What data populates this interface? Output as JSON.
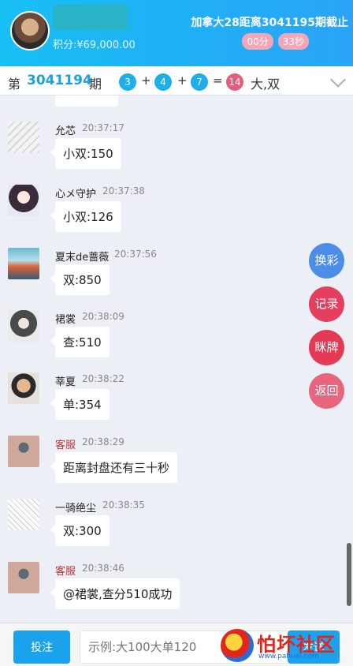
{
  "header": {
    "score": "积分:¥69,000.00",
    "countdown_title": "加拿大28距离3041195期截止",
    "minutes": "00分",
    "seconds": "33秒"
  },
  "period": {
    "prefix": "第",
    "number": "3041194",
    "suffix": "期",
    "balls": [
      "3",
      "4",
      "7"
    ],
    "sum": "14",
    "result": "大,双",
    "plus": "+",
    "equals": "="
  },
  "messages": [
    {
      "user": "允芯",
      "time": "20:37:17",
      "text": "小双:150"
    },
    {
      "user": "心メ守护",
      "time": "20:37:38",
      "text": "小双:126"
    },
    {
      "user": "夏末de蔷薇",
      "time": "20:37:56",
      "text": "双:850"
    },
    {
      "user": "裙裳",
      "time": "20:38:09",
      "text": "查:510"
    },
    {
      "user": "莘夏",
      "time": "20:38:22",
      "text": "单:354"
    },
    {
      "user": "客服",
      "time": "20:38:29",
      "text": "距离封盘还有三十秒"
    },
    {
      "user": "一骑绝尘",
      "time": "20:38:35",
      "text": "双:300"
    },
    {
      "user": "客服",
      "time": "20:38:46",
      "text": "@裙裳,查分510成功"
    }
  ],
  "side_buttons": {
    "exchange": "换彩",
    "records": "记录",
    "squeeze": "眯牌",
    "back": "返回"
  },
  "bottom": {
    "bet": "投注",
    "placeholder": "示例:大100大单120",
    "send": "发送"
  },
  "watermark": {
    "text": "怕坏社区",
    "url": "www.pahuai.com"
  },
  "colors": {
    "header_start": "#18c0f5",
    "accent": "#1aa3ec",
    "staff_name": "#c63030"
  }
}
